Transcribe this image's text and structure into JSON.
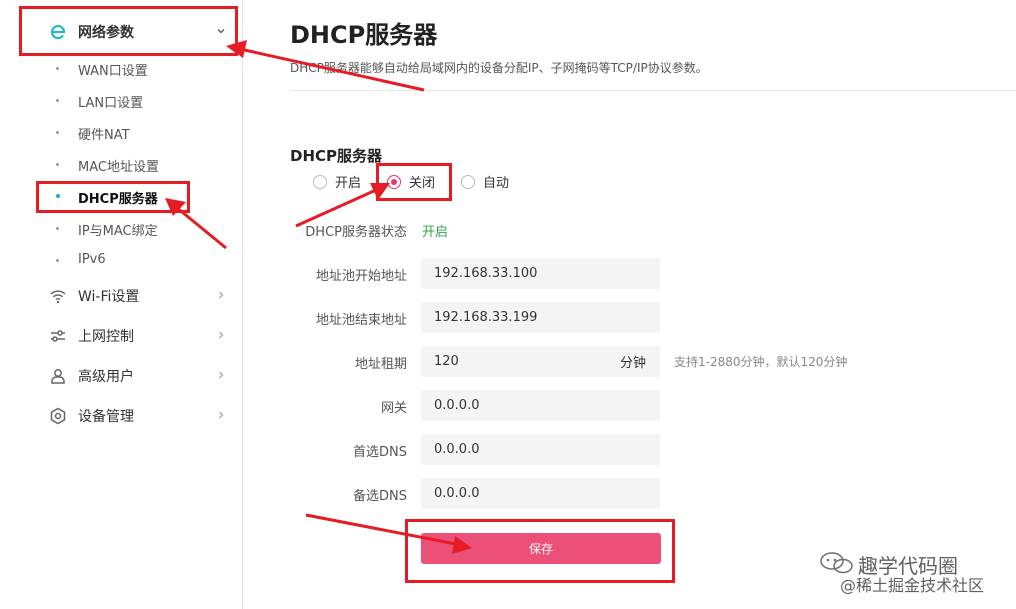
{
  "sidebar": {
    "network": {
      "label": "网络参数",
      "icon": "brand-e-icon"
    },
    "sub_items": [
      "WAN口设置",
      "LAN口设置",
      "硬件NAT",
      "MAC地址设置",
      "DHCP服务器",
      "IP与MAC绑定",
      "IPv6"
    ],
    "wifi": {
      "label": "Wi-Fi设置",
      "icon": "wifi-icon"
    },
    "internet_control": {
      "label": "上网控制",
      "icon": "sliders-icon"
    },
    "advanced_user": {
      "label": "高级用户",
      "icon": "user-icon"
    },
    "device_mgmt": {
      "label": "设备管理",
      "icon": "gear-icon"
    }
  },
  "main": {
    "title": "DHCP服务器",
    "description": "DHCP服务器能够自动给局域网内的设备分配IP、子网掩码等TCP/IP协议参数。",
    "section_title": "DHCP服务器",
    "radio": {
      "on": "开启",
      "off": "关闭",
      "auto": "自动",
      "selected": "关闭"
    },
    "status_label": "DHCP服务器状态",
    "status_value": "开启",
    "pool_start_label": "地址池开始地址",
    "pool_start_value": "192.168.33.100",
    "pool_end_label": "地址池结束地址",
    "pool_end_value": "192.168.33.199",
    "lease_label": "地址租期",
    "lease_value": "120",
    "lease_unit": "分钟",
    "lease_hint": "支持1-2880分钟，默认120分钟",
    "gateway_label": "网关",
    "gateway_value": "0.0.0.0",
    "dns1_label": "首选DNS",
    "dns1_value": "0.0.0.0",
    "dns2_label": "备选DNS",
    "dns2_value": "0.0.0.0",
    "save_label": "保存"
  },
  "watermark": {
    "line1": "趣学代码圈",
    "line2": "@稀土掘金技术社区"
  },
  "colors": {
    "accent": "#ec4f78",
    "annotation": "#e51c23",
    "status_green": "#2aa84a",
    "active_dot": "#1fa8e0"
  }
}
